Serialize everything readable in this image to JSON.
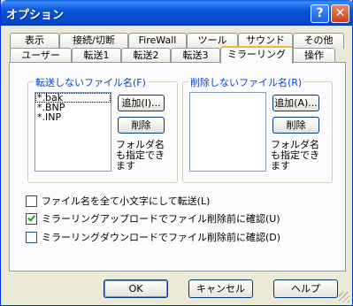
{
  "window": {
    "title": "オプション",
    "help_glyph": "?",
    "close_glyph": "✕"
  },
  "tabs_row1": [
    "表示",
    "接続/切断",
    "FireWall",
    "ツール",
    "サウンド",
    "その他"
  ],
  "tabs_row2": [
    "ユーザー",
    "転送1",
    "転送2",
    "転送3",
    "ミラーリング",
    "操作"
  ],
  "active_tab": "ミラーリング",
  "no_transfer_group": {
    "legend": "転送しないファイル名(F)",
    "items": [
      "*.bak",
      "*.BNP",
      "*.INP"
    ],
    "add_label": "追加(I)...",
    "delete_label": "削除",
    "hint": "フォルダ名も指定できます"
  },
  "no_delete_group": {
    "legend": "削除しないファイル名(R)",
    "items": [],
    "add_label": "追加(A)...",
    "delete_label": "削除",
    "hint": "フォルダ名も指定できます"
  },
  "options": [
    {
      "label": "ファイル名を全て小文字にして転送(L)",
      "checked": false
    },
    {
      "label": "ミラーリングアップロードでファイル削除前に確認(U)",
      "checked": true
    },
    {
      "label": "ミラーリングダウンロードでファイル削除前に確認(D)",
      "checked": false
    }
  ],
  "buttons": {
    "ok": "OK",
    "cancel": "キャンセル",
    "help": "ヘルプ"
  }
}
